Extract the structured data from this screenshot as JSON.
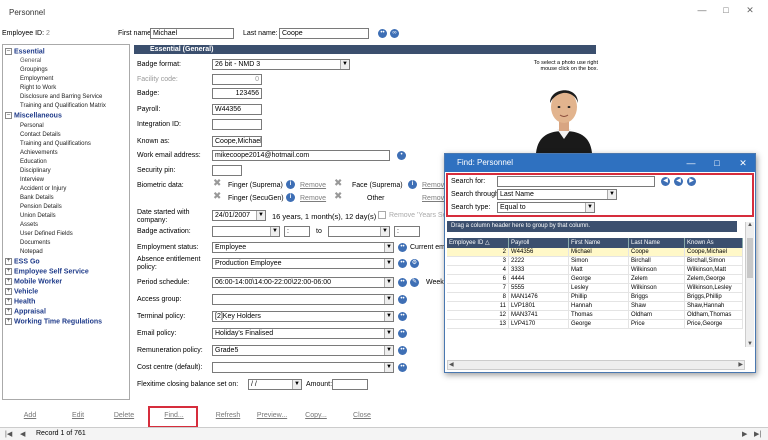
{
  "window": {
    "title": "Personnel"
  },
  "header": {
    "employee_id_label": "Employee ID:",
    "employee_id": "2",
    "first_name_label": "First name:",
    "first_name": "Michael",
    "last_name_label": "Last name:",
    "last_name": "Coope"
  },
  "tree": {
    "groups": [
      {
        "label": "Essential",
        "expanded": true,
        "items": [
          "General",
          "Groupings",
          "Employment",
          "Right to Work",
          "Disclosure and Barring Service",
          "Training and Qualification Matrix"
        ]
      },
      {
        "label": "Miscellaneous",
        "expanded": true,
        "items": [
          "Personal",
          "Contact Details",
          "Training and Qualifications",
          "Achievements",
          "Education",
          "Disciplinary",
          "Interview",
          "Accident or Injury",
          "Bank Details",
          "Pension Details",
          "Union Details",
          "Assets",
          "User Defined Fields",
          "Documents",
          "Notepad"
        ]
      },
      {
        "label": "ESS Go",
        "expanded": false,
        "items": []
      },
      {
        "label": "Employee Self Service",
        "expanded": false,
        "items": []
      },
      {
        "label": "Mobile Worker",
        "expanded": false,
        "items": []
      },
      {
        "label": "Vehicle",
        "expanded": false,
        "items": []
      },
      {
        "label": "Health",
        "expanded": false,
        "items": []
      },
      {
        "label": "Appraisal",
        "expanded": false,
        "items": []
      },
      {
        "label": "Working Time Regulations",
        "expanded": false,
        "items": []
      }
    ]
  },
  "section": {
    "title": "Essential (General)"
  },
  "form": {
    "badge_format_label": "Badge format:",
    "badge_format": "26 bit - NMD 3",
    "facility_code_label": "Facility code:",
    "facility_code": "0",
    "badge_label": "Badge:",
    "badge": "123456",
    "payroll_label": "Payroll:",
    "payroll": "W44356",
    "integration_id_label": "Integration ID:",
    "integration_id": "",
    "known_as_label": "Known as:",
    "known_as": "Coope,Michael",
    "work_email_label": "Work email address:",
    "work_email": "mikecoope2014@hotmail.com",
    "security_pin_label": "Security pin:",
    "security_pin": "",
    "biometric_label": "Biometric data:",
    "finger_suprema": "Finger (Suprema)",
    "finger_secugen": "Finger (SecuGen)",
    "face_suprema": "Face (Suprema)",
    "other": "Other",
    "remove": "Remove",
    "date_started_label": "Date started with company:",
    "date_started": "24/01/2007",
    "service_length": "16 years, 1 month(s), 12 day(s)",
    "remove_years_service": "Remove 'Years Ser",
    "badge_activation_label": "Badge activation:",
    "to_label": "to",
    "employment_status_label": "Employment status:",
    "employment_status": "Employee",
    "current_emp": "Current emp",
    "absence_entitlement_label": "Absence entitlement policy:",
    "absence_entitlement": "Production Employee",
    "period_schedule_label": "Period schedule:",
    "period_schedule": "06:00-14:00\\14:00-22:00\\22:00-06:00",
    "week": "Week",
    "access_group_label": "Access group:",
    "access_group": "",
    "terminal_policy_label": "Terminal policy:",
    "terminal_policy": "[2]Key Holders",
    "email_policy_label": "Email policy:",
    "email_policy": "Holiday's Finalised",
    "remuneration_label": "Remuneration policy:",
    "remuneration": "Grade5",
    "cost_centre_label": "Cost centre (default):",
    "cost_centre": "",
    "flexitime_label": "Flexitime closing balance set on:",
    "flexitime_date": " / /",
    "amount_label": "Amount:",
    "amount": ""
  },
  "photo": {
    "hint": "To select a photo use right mouse click on the box."
  },
  "buttons": [
    "Add",
    "Edit",
    "Delete",
    "Find...",
    "Refresh",
    "Preview...",
    "Copy...",
    "Close"
  ],
  "record_nav": {
    "text": "Record 1 of 761"
  },
  "find_dialog": {
    "title": "Find: Personnel",
    "search_for_label": "Search for:",
    "search_for": "",
    "search_through_label": "Search through:",
    "search_through": "Last Name",
    "search_type_label": "Search type:",
    "search_type": "Equal to",
    "group_hint": "Drag a column header here to group by that column.",
    "columns": [
      "Employee ID △",
      "Payroll",
      "First Name",
      "Last Name",
      "Known As"
    ],
    "rows": [
      [
        "2",
        "W44356",
        "Michael",
        "Coope",
        "Coope,Michael"
      ],
      [
        "3",
        "2222",
        "Simon",
        "Birchall",
        "Birchall,Simon"
      ],
      [
        "4",
        "3333",
        "Matt",
        "Wilkinson",
        "Wilkinson,Matt"
      ],
      [
        "6",
        "4444",
        "George",
        "Zelem",
        "Zelem,George"
      ],
      [
        "7",
        "5555",
        "Lesley",
        "Wilkinson",
        "Wilkinson,Lesley"
      ],
      [
        "8",
        "MAN1476",
        "Phillip",
        "Briggs",
        "Briggs,Phillip"
      ],
      [
        "11",
        "LVP1801",
        "Hannah",
        "Shaw",
        "Shaw,Hannah"
      ],
      [
        "12",
        "MAN3741",
        "Thomas",
        "Oldham",
        "Oldham,Thomas"
      ],
      [
        "13",
        "LVP4170",
        "George",
        "Price",
        "Price,George"
      ]
    ]
  },
  "colors": {
    "accent": "#2f71c0",
    "header": "#3b4f6e",
    "highlight": "#d62d3c",
    "selected_row": "#fff8c8"
  }
}
